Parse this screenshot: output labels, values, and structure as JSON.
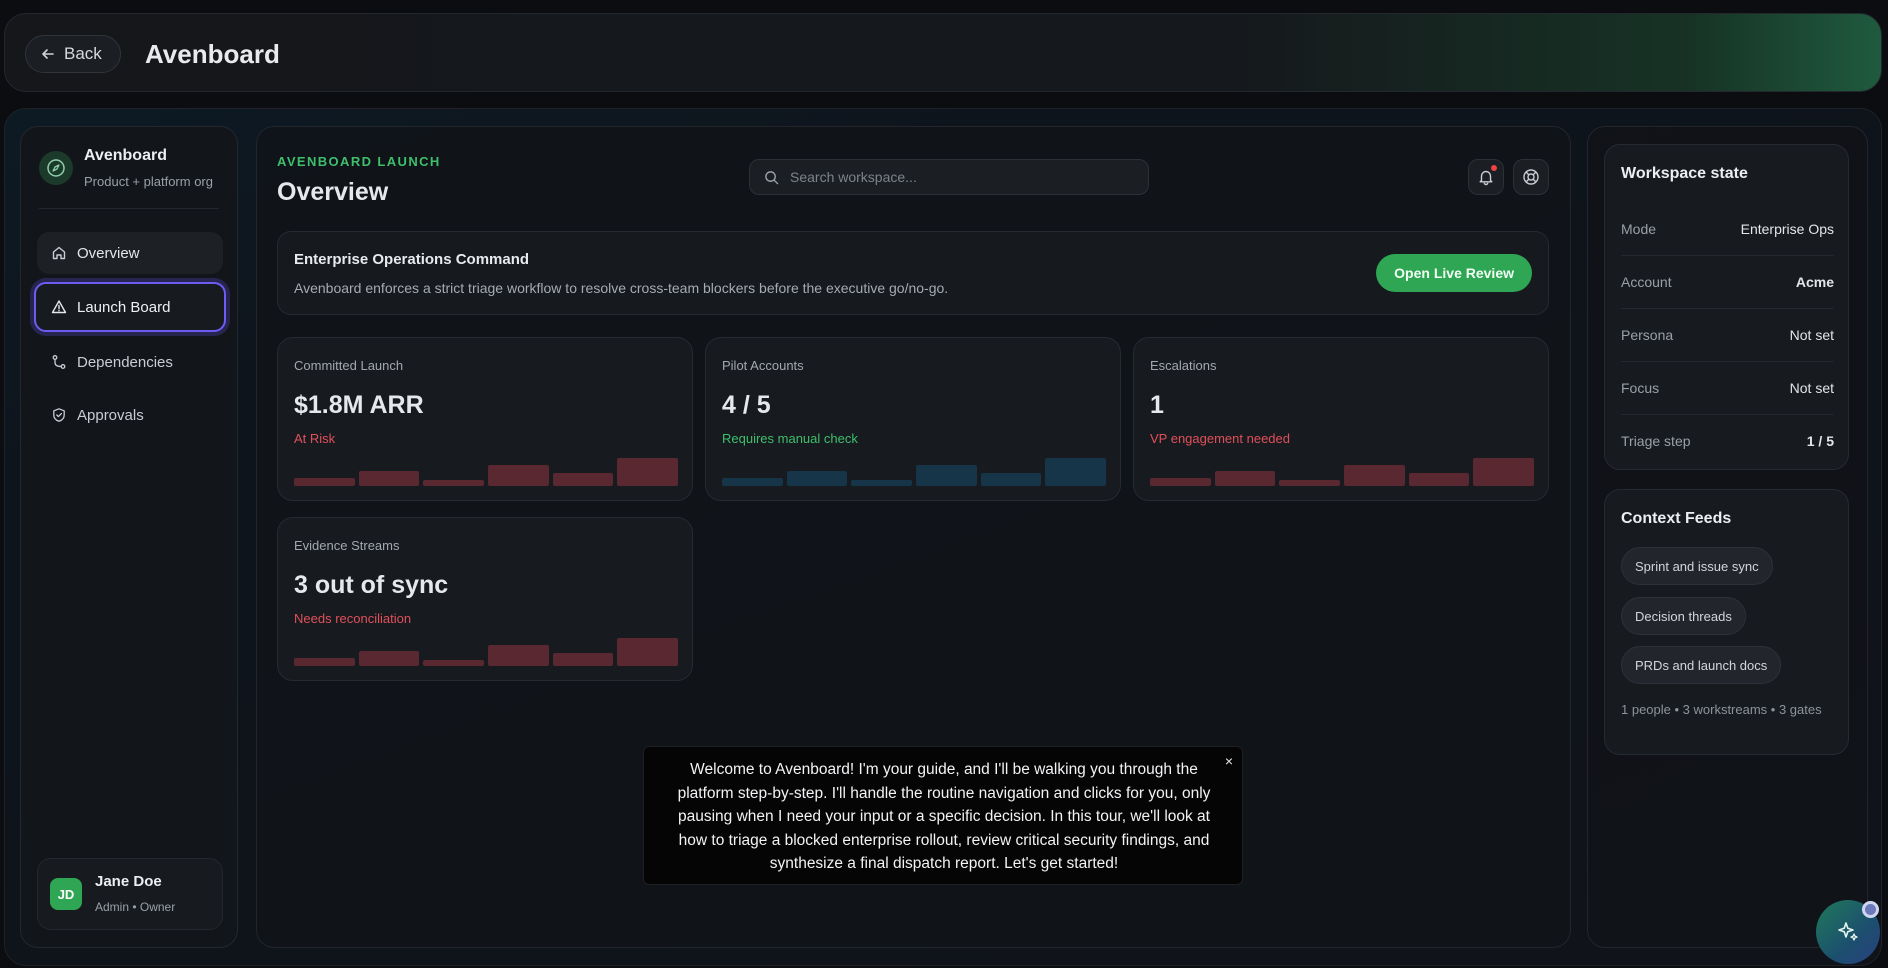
{
  "header": {
    "back_label": "Back",
    "title": "Avenboard"
  },
  "sidebar": {
    "org_name": "Avenboard",
    "org_sub": "Product + platform org",
    "items": [
      {
        "label": "Overview",
        "icon": "home-icon"
      },
      {
        "label": "Launch Board",
        "icon": "warning-triangle-icon"
      },
      {
        "label": "Dependencies",
        "icon": "branch-icon"
      },
      {
        "label": "Approvals",
        "icon": "shield-icon"
      }
    ],
    "user": {
      "initials": "JD",
      "name": "Jane Doe",
      "role": "Admin • Owner"
    }
  },
  "main": {
    "eyebrow": "AVENBOARD LAUNCH",
    "title": "Overview",
    "search_placeholder": "Search workspace...",
    "command": {
      "title": "Enterprise Operations Command",
      "description": "Avenboard enforces a strict triage workflow to resolve cross-team blockers before the executive go/no-go.",
      "button": "Open Live Review"
    },
    "metrics": [
      {
        "label": "Committed Launch",
        "value": "$1.8M ARR",
        "status": "At Risk",
        "status_color": "#e0505a",
        "bar_color": "#5a2830"
      },
      {
        "label": "Pilot Accounts",
        "value": "4 / 5",
        "status": "Requires manual check",
        "status_color": "#3fbf6c",
        "bar_color": "#173548"
      },
      {
        "label": "Escalations",
        "value": "1",
        "status": "VP engagement needed",
        "status_color": "#e0505a",
        "bar_color": "#5a2830"
      },
      {
        "label": "Evidence Streams",
        "value": "3 out of sync",
        "status": "Needs reconciliation",
        "status_color": "#e0505a",
        "bar_color": "#5a2830"
      }
    ]
  },
  "workspace": {
    "title": "Workspace state",
    "rows": [
      {
        "key": "Mode",
        "value": "Enterprise Ops"
      },
      {
        "key": "Account",
        "value": "Acme"
      },
      {
        "key": "Persona",
        "value": "Not set"
      },
      {
        "key": "Focus",
        "value": "Not set"
      },
      {
        "key": "Triage step",
        "value": "1 / 5"
      }
    ]
  },
  "context": {
    "title": "Context Feeds",
    "chips": [
      "Sprint and issue sync",
      "Decision threads",
      "PRDs and launch docs"
    ],
    "footer": "1 people • 3 workstreams • 3 gates"
  },
  "tour": {
    "text": "Welcome to Avenboard! I'm your guide, and I'll be walking you through the platform step-by-step. I'll handle the routine navigation and clicks for you, only pausing when I need your input or a specific decision. In this tour, we'll look at how to triage a blocked enterprise rollout, review critical security findings, and synthesize a final dispatch report. Let's get started!",
    "close": "×"
  },
  "assistant": {
    "icon": "sparkle-icon"
  }
}
